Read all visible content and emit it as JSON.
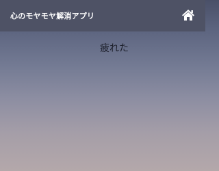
{
  "header": {
    "title": "心のモヤモヤ解消アプリ",
    "home_icon": "home-icon"
  },
  "main": {
    "mood_text": "疲れた"
  },
  "colors": {
    "header_bg": "#4e5265",
    "header_text": "#ffffff",
    "gradient_top": "#4a5068",
    "gradient_bottom": "#b4a8aa"
  }
}
